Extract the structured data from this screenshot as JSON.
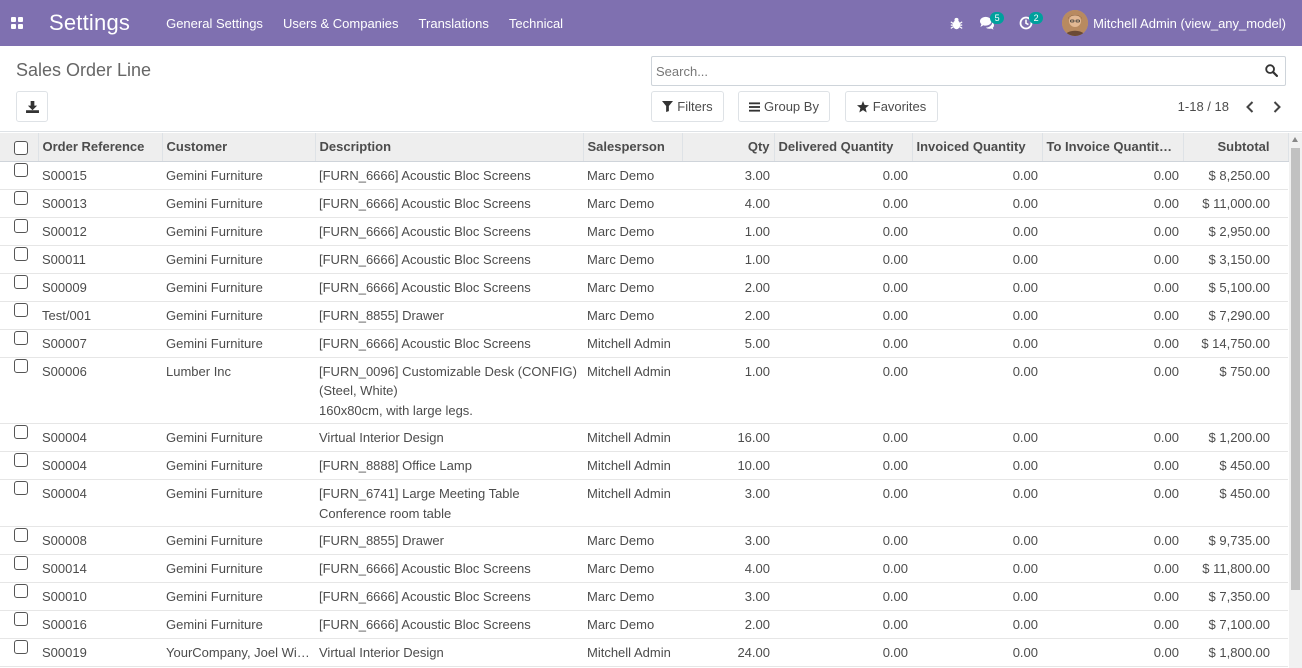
{
  "navbar": {
    "app_title": "Settings",
    "menu": [
      "General Settings",
      "Users & Companies",
      "Translations",
      "Technical"
    ],
    "messages_count": "5",
    "activities_count": "2",
    "user_name": "Mitchell Admin (view_any_model)",
    "bg_color": "#7f70b0"
  },
  "control_panel": {
    "title": "Sales Order Line",
    "search_placeholder": "Search...",
    "filters_label": "Filters",
    "group_by_label": "Group By",
    "favorites_label": "Favorites",
    "pager_value": "1-18 / 18"
  },
  "table": {
    "columns": [
      "Order Reference",
      "Customer",
      "Description",
      "Salesperson",
      "Qty",
      "Delivered Quantity",
      "Invoiced Quantity",
      "To Invoice Quantity…",
      "Subtotal"
    ],
    "rows": [
      {
        "ref": "S00015",
        "customer": "Gemini Furniture",
        "description": [
          "[FURN_6666] Acoustic Bloc Screens"
        ],
        "salesperson": "Marc Demo",
        "qty": "3.00",
        "delivered": "0.00",
        "invoiced": "0.00",
        "to_invoice": "0.00",
        "subtotal": "$ 8,250.00"
      },
      {
        "ref": "S00013",
        "customer": "Gemini Furniture",
        "description": [
          "[FURN_6666] Acoustic Bloc Screens"
        ],
        "salesperson": "Marc Demo",
        "qty": "4.00",
        "delivered": "0.00",
        "invoiced": "0.00",
        "to_invoice": "0.00",
        "subtotal": "$ 11,000.00"
      },
      {
        "ref": "S00012",
        "customer": "Gemini Furniture",
        "description": [
          "[FURN_6666] Acoustic Bloc Screens"
        ],
        "salesperson": "Marc Demo",
        "qty": "1.00",
        "delivered": "0.00",
        "invoiced": "0.00",
        "to_invoice": "0.00",
        "subtotal": "$ 2,950.00"
      },
      {
        "ref": "S00011",
        "customer": "Gemini Furniture",
        "description": [
          "[FURN_6666] Acoustic Bloc Screens"
        ],
        "salesperson": "Marc Demo",
        "qty": "1.00",
        "delivered": "0.00",
        "invoiced": "0.00",
        "to_invoice": "0.00",
        "subtotal": "$ 3,150.00"
      },
      {
        "ref": "S00009",
        "customer": "Gemini Furniture",
        "description": [
          "[FURN_6666] Acoustic Bloc Screens"
        ],
        "salesperson": "Marc Demo",
        "qty": "2.00",
        "delivered": "0.00",
        "invoiced": "0.00",
        "to_invoice": "0.00",
        "subtotal": "$ 5,100.00"
      },
      {
        "ref": "Test/001",
        "customer": "Gemini Furniture",
        "description": [
          "[FURN_8855] Drawer"
        ],
        "salesperson": "Marc Demo",
        "qty": "2.00",
        "delivered": "0.00",
        "invoiced": "0.00",
        "to_invoice": "0.00",
        "subtotal": "$ 7,290.00"
      },
      {
        "ref": "S00007",
        "customer": "Gemini Furniture",
        "description": [
          "[FURN_6666] Acoustic Bloc Screens"
        ],
        "salesperson": "Mitchell Admin",
        "qty": "5.00",
        "delivered": "0.00",
        "invoiced": "0.00",
        "to_invoice": "0.00",
        "subtotal": "$ 14,750.00"
      },
      {
        "ref": "S00006",
        "customer": "Lumber Inc",
        "description": [
          "[FURN_0096] Customizable Desk (CONFIG)",
          "(Steel, White)",
          "160x80cm, with large legs."
        ],
        "salesperson": "Mitchell Admin",
        "qty": "1.00",
        "delivered": "0.00",
        "invoiced": "0.00",
        "to_invoice": "0.00",
        "subtotal": "$ 750.00"
      },
      {
        "ref": "S00004",
        "customer": "Gemini Furniture",
        "description": [
          "Virtual Interior Design"
        ],
        "salesperson": "Mitchell Admin",
        "qty": "16.00",
        "delivered": "0.00",
        "invoiced": "0.00",
        "to_invoice": "0.00",
        "subtotal": "$ 1,200.00"
      },
      {
        "ref": "S00004",
        "customer": "Gemini Furniture",
        "description": [
          "[FURN_8888] Office Lamp"
        ],
        "salesperson": "Mitchell Admin",
        "qty": "10.00",
        "delivered": "0.00",
        "invoiced": "0.00",
        "to_invoice": "0.00",
        "subtotal": "$ 450.00"
      },
      {
        "ref": "S00004",
        "customer": "Gemini Furniture",
        "description": [
          "[FURN_6741] Large Meeting Table",
          "Conference room table"
        ],
        "salesperson": "Mitchell Admin",
        "qty": "3.00",
        "delivered": "0.00",
        "invoiced": "0.00",
        "to_invoice": "0.00",
        "subtotal": "$ 450.00"
      },
      {
        "ref": "S00008",
        "customer": "Gemini Furniture",
        "description": [
          "[FURN_8855] Drawer"
        ],
        "salesperson": "Marc Demo",
        "qty": "3.00",
        "delivered": "0.00",
        "invoiced": "0.00",
        "to_invoice": "0.00",
        "subtotal": "$ 9,735.00"
      },
      {
        "ref": "S00014",
        "customer": "Gemini Furniture",
        "description": [
          "[FURN_6666] Acoustic Bloc Screens"
        ],
        "salesperson": "Marc Demo",
        "qty": "4.00",
        "delivered": "0.00",
        "invoiced": "0.00",
        "to_invoice": "0.00",
        "subtotal": "$ 11,800.00"
      },
      {
        "ref": "S00010",
        "customer": "Gemini Furniture",
        "description": [
          "[FURN_6666] Acoustic Bloc Screens"
        ],
        "salesperson": "Marc Demo",
        "qty": "3.00",
        "delivered": "0.00",
        "invoiced": "0.00",
        "to_invoice": "0.00",
        "subtotal": "$ 7,350.00"
      },
      {
        "ref": "S00016",
        "customer": "Gemini Furniture",
        "description": [
          "[FURN_6666] Acoustic Bloc Screens"
        ],
        "salesperson": "Marc Demo",
        "qty": "2.00",
        "delivered": "0.00",
        "invoiced": "0.00",
        "to_invoice": "0.00",
        "subtotal": "$ 7,100.00"
      },
      {
        "ref": "S00019",
        "customer": "YourCompany, Joel Wi…",
        "description": [
          "Virtual Interior Design"
        ],
        "salesperson": "Mitchell Admin",
        "qty": "24.00",
        "delivered": "0.00",
        "invoiced": "0.00",
        "to_invoice": "0.00",
        "subtotal": "$ 1,800.00"
      }
    ]
  }
}
